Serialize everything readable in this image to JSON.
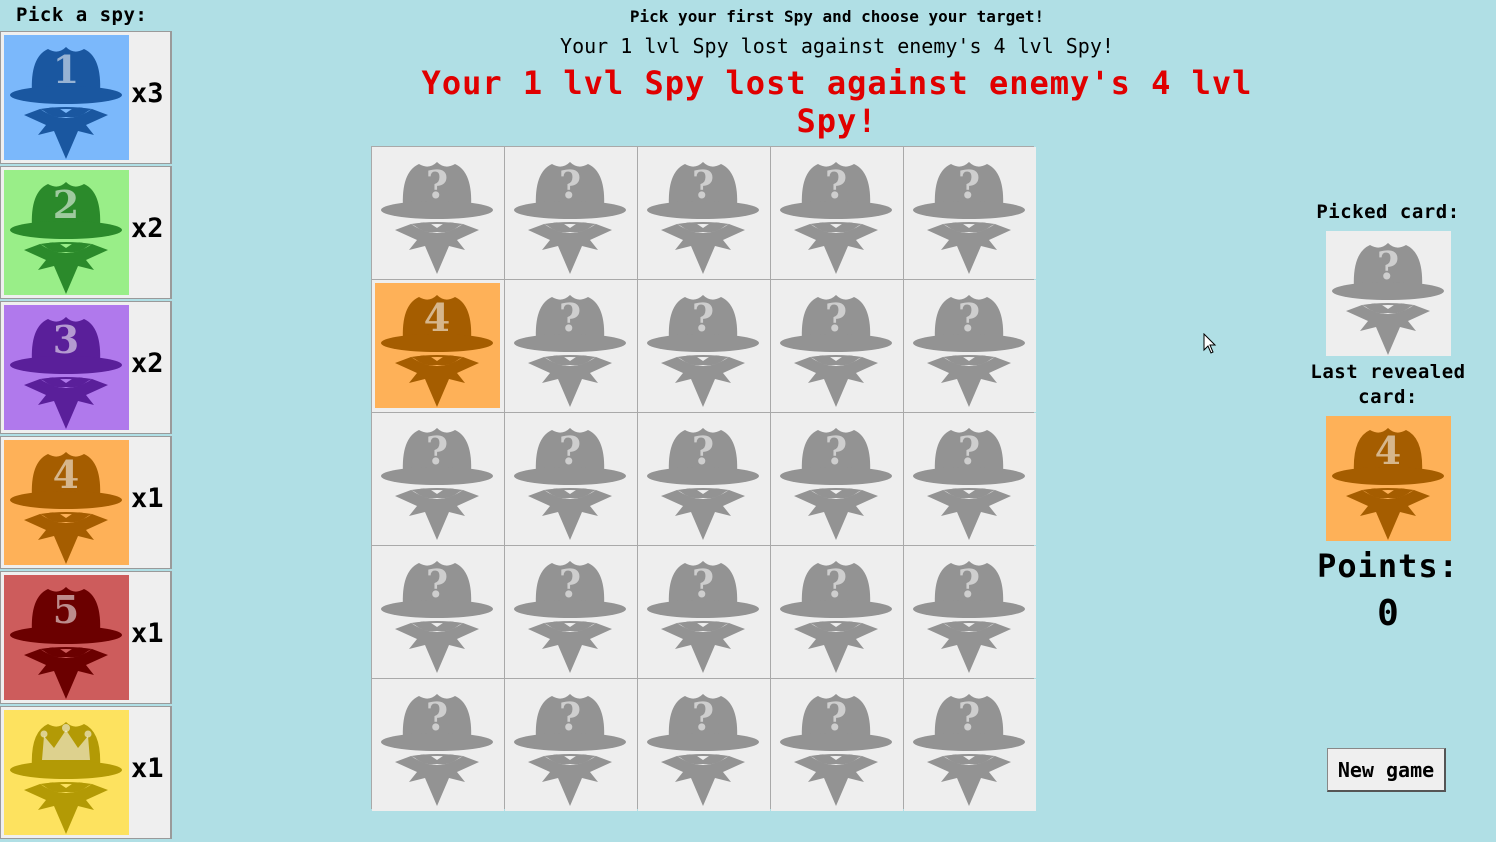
{
  "sidebar": {
    "title": "Pick a spy:",
    "items": [
      {
        "label": "1",
        "count": "x3",
        "bg": "#7bb8fb",
        "fg": "#1a57a0",
        "icon": "spy-1-icon"
      },
      {
        "label": "2",
        "count": "x2",
        "bg": "#99ee88",
        "fg": "#2b8a2b",
        "icon": "spy-2-icon"
      },
      {
        "label": "3",
        "count": "x2",
        "bg": "#b079ec",
        "fg": "#5a1f9a",
        "icon": "spy-3-icon"
      },
      {
        "label": "4",
        "count": "x1",
        "bg": "#feb158",
        "fg": "#a55d00",
        "icon": "spy-4-icon"
      },
      {
        "label": "5",
        "count": "x1",
        "bg": "#cd5c5c",
        "fg": "#6b0000",
        "icon": "spy-5-icon"
      },
      {
        "label": "",
        "count": "x1",
        "bg": "#fde25f",
        "fg": "#b39a05",
        "icon": "spy-king-icon",
        "crown": true
      }
    ]
  },
  "header": {
    "instruction": "Pick your first Spy and choose your target!",
    "result": "Your 1 lvl Spy lost against enemy's 4 lvl Spy!",
    "result_big": "Your 1 lvl Spy lost against enemy's 4 lvl Spy!"
  },
  "board": {
    "hidden_label": "?",
    "hidden_fg": "#939393",
    "hidden_bg": "#eeeeee",
    "revealed": [
      {
        "row": 1,
        "col": 0,
        "label": "4",
        "bg": "#feb158",
        "fg": "#a55d00"
      }
    ]
  },
  "right_panel": {
    "picked_label": "Picked card:",
    "last_label": "Last revealed card:",
    "last_card": {
      "label": "4",
      "bg": "#feb158",
      "fg": "#a55d00"
    },
    "points_label": "Points:",
    "points_value": "0"
  },
  "new_game_label": "New game"
}
